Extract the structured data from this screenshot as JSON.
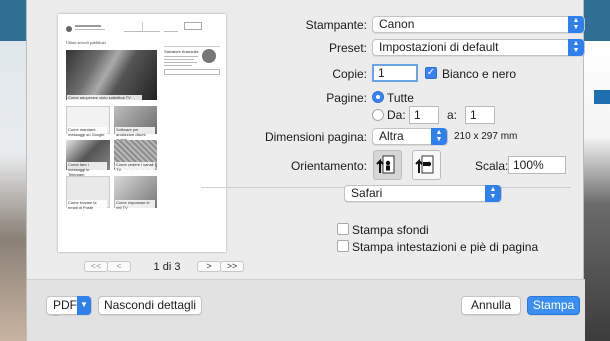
{
  "form": {
    "printer": {
      "label": "Stampante:",
      "value": "Canon"
    },
    "preset": {
      "label": "Preset:",
      "value": "Impostazioni di default"
    },
    "copies": {
      "label": "Copie:",
      "value": "1",
      "bw_label": "Bianco e nero",
      "bw_checked": true
    },
    "pages": {
      "label": "Pagine:",
      "all_label": "Tutte",
      "from_label": "Da:",
      "from_value": "1",
      "to_label": "a:",
      "to_value": "1",
      "selected": "all"
    },
    "paper_size": {
      "label": "Dimensioni pagina:",
      "value": "Altra",
      "dimensions": "210 x 297 mm"
    },
    "orientation": {
      "label": "Orientamento:",
      "selected": "portrait"
    },
    "scale": {
      "label": "Scala:",
      "value": "100%"
    },
    "section": {
      "value": "Safari"
    },
    "print_backgrounds": {
      "label": "Stampa sfondi",
      "checked": false
    },
    "print_headers": {
      "label": "Stampa intestazioni e piè di pagina",
      "checked": false
    }
  },
  "preview": {
    "pager": {
      "label": "1 di 3",
      "first": "<<",
      "prev": "<",
      "next": ">",
      "last": ">>"
    },
    "page": {
      "section_title": "Ultimi articoli pubblicati",
      "header_tag": "Salvatore Aranzulla Blog",
      "big_caption": "Come adoperare ciuto sottotitos TV",
      "sidebar_name": "Salvatore Aranzulla",
      "captions": [
        "Come mandare messaggi su Google",
        "Software per analizzare dischi guasti",
        "Come fare i messaggi in Telegram",
        "Come vedere i canali TV",
        "Come trovare la email di Poste",
        "Come impostare le reti TV"
      ]
    }
  },
  "footer": {
    "help": "?",
    "pdf": "PDF",
    "hide_details": "Nascondi dettagli",
    "cancel": "Annulla",
    "print": "Stampa"
  }
}
